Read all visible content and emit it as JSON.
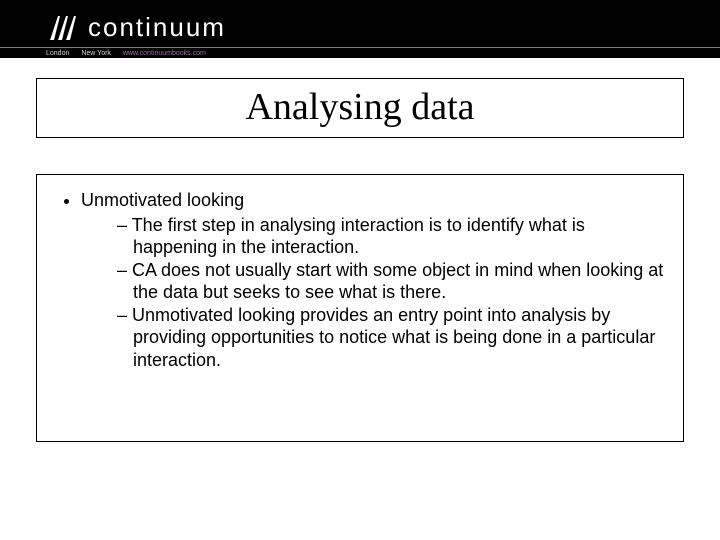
{
  "header": {
    "brand": "continuum",
    "subheader_left": "London",
    "subheader_mid": "New York",
    "subheader_url": "www.continuumbooks.com"
  },
  "title": "Analysing data",
  "content": {
    "top_item": "Unmotivated looking",
    "sub_items": [
      "The first step in analysing interaction is to identify what is happening in the interaction.",
      "CA does not usually start with some object in mind when looking at the data but seeks to see what is there.",
      "Unmotivated looking provides an entry point into analysis by providing opportunities to notice what is being done in a particular interaction."
    ]
  }
}
